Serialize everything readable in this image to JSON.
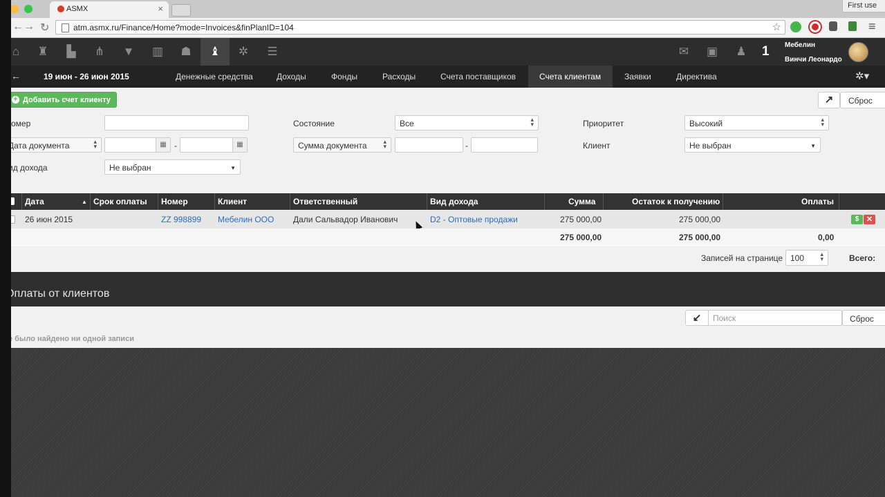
{
  "browser": {
    "tab_title": "ASMX",
    "tab_close": "×",
    "url": "atm.asmx.ru/Finance/Home?mode=Invoices&finPlanID=104",
    "first_use": "First use"
  },
  "header": {
    "notifications_count": "1",
    "user_line1": "Мебелин",
    "user_line2": "Винчи Леонардо",
    "icons": [
      "home-icon",
      "org-icon",
      "factory-icon",
      "hierarchy-icon",
      "filter-icon",
      "bar-chart-icon",
      "hat-icon",
      "money-bag-icon",
      "gear-icon",
      "list-icon",
      "mail-icon",
      "briefcase-icon",
      "bell-icon"
    ]
  },
  "subnav": {
    "back_icon": "←",
    "date_range": "19 июн - 26 июн 2015",
    "items": [
      "Денежные средства",
      "Доходы",
      "Фонды",
      "Расходы",
      "Счета поставщиков",
      "Счета клиентам",
      "Заявки",
      "Директива"
    ],
    "active": "Счета клиентам"
  },
  "toolbar": {
    "add_label": "Добавить счет клиенту",
    "reset_label": "Сброс"
  },
  "filters": {
    "number_label": "омер",
    "state_label": "Состояние",
    "state_value": "Все",
    "priority_label": "Приоритет",
    "priority_value": "Высокий",
    "date_select": "Дата документа",
    "range_dash": "-",
    "sum_select": "Сумма документа",
    "client_label": "Клиент",
    "client_value": "Не выбран",
    "income_label": "ид дохода",
    "income_value": "Не выбран"
  },
  "table": {
    "headers": [
      "Дата",
      "Срок оплаты",
      "Номер",
      "Клиент",
      "Ответственный",
      "Вид дохода",
      "Сумма",
      "Остаток к получению",
      "Оплаты"
    ],
    "row": {
      "date": "26 июн 2015",
      "due": "",
      "number": "ZZ 998899",
      "client": "Мебелин ООО",
      "responsible": "Дали Сальвадор Иванович",
      "income_type": "D2 - Оптовые продажи",
      "sum": "275 000,00",
      "remaining": "275 000,00",
      "payments": ""
    },
    "totals": {
      "sum": "275 000,00",
      "remaining": "275 000,00",
      "payments": "0,00"
    },
    "pay_button": "$",
    "delete_button": "✕",
    "per_page_label": "Записей на странице",
    "per_page_value": "100",
    "total_label": "Всего:"
  },
  "payments_section": {
    "title": "Оплаты от клиентов",
    "search_placeholder": "Поиск",
    "reset_label": "Сброс",
    "empty_text": "е было найдено ни одной записи"
  },
  "colors": {
    "accent_green": "#5cb85c",
    "danger_red": "#d9534f",
    "link_blue": "#2a6ebb",
    "header_dark": "#2d2d2d"
  }
}
